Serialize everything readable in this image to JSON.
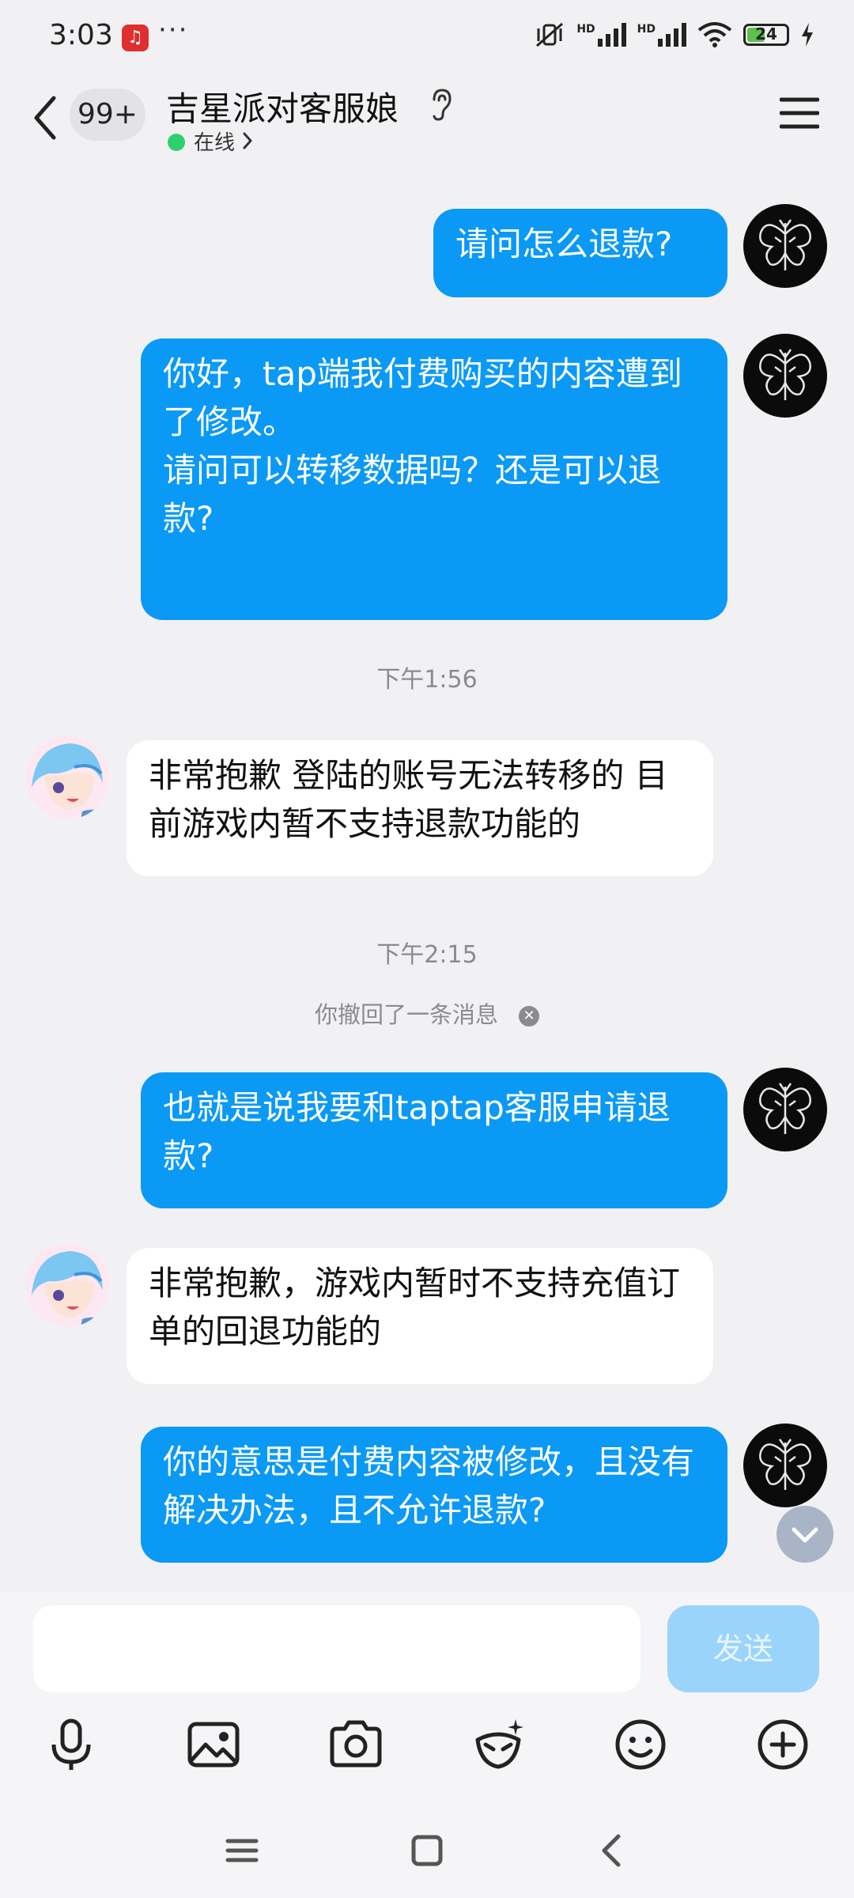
{
  "status_bar": {
    "time": "3:03",
    "more": "···",
    "battery": "24",
    "hd1": "HD",
    "hd2": "HD"
  },
  "header": {
    "badge": "99+",
    "title": "吉星派对客服娘",
    "online": "在线"
  },
  "messages": [
    {
      "type": "outgoing",
      "text": "请问怎么退款?"
    },
    {
      "type": "outgoing",
      "text": "你好，tap端我付费购买的内容遭到了修改。\n请问可以转移数据吗？还是可以退款?"
    },
    {
      "type": "timestamp",
      "text": "下午1:56"
    },
    {
      "type": "incoming",
      "text": "非常抱歉 登陆的账号无法转移的 目前游戏内暂不支持退款功能的"
    },
    {
      "type": "timestamp",
      "text": "下午2:15"
    },
    {
      "type": "system",
      "text": "你撤回了一条消息"
    },
    {
      "type": "outgoing",
      "text": "也就是说我要和taptap客服申请退款?"
    },
    {
      "type": "incoming",
      "text": "非常抱歉，游戏内暂时不支持充值订单的回退功能的"
    },
    {
      "type": "outgoing",
      "text": "你的意思是付费内容被修改，且没有解决办法，且不允许退款?"
    }
  ],
  "input": {
    "placeholder": "",
    "send_label": "发送"
  },
  "toolbar": [
    "microphone-icon",
    "image-icon",
    "camera-icon",
    "red-packet-icon",
    "emoji-icon",
    "plus-icon"
  ],
  "colors": {
    "outgoing_bubble": "#0a99f5",
    "incoming_bubble": "#ffffff",
    "online_dot": "#2fd06c",
    "send_disabled": "#9bd4fb"
  }
}
